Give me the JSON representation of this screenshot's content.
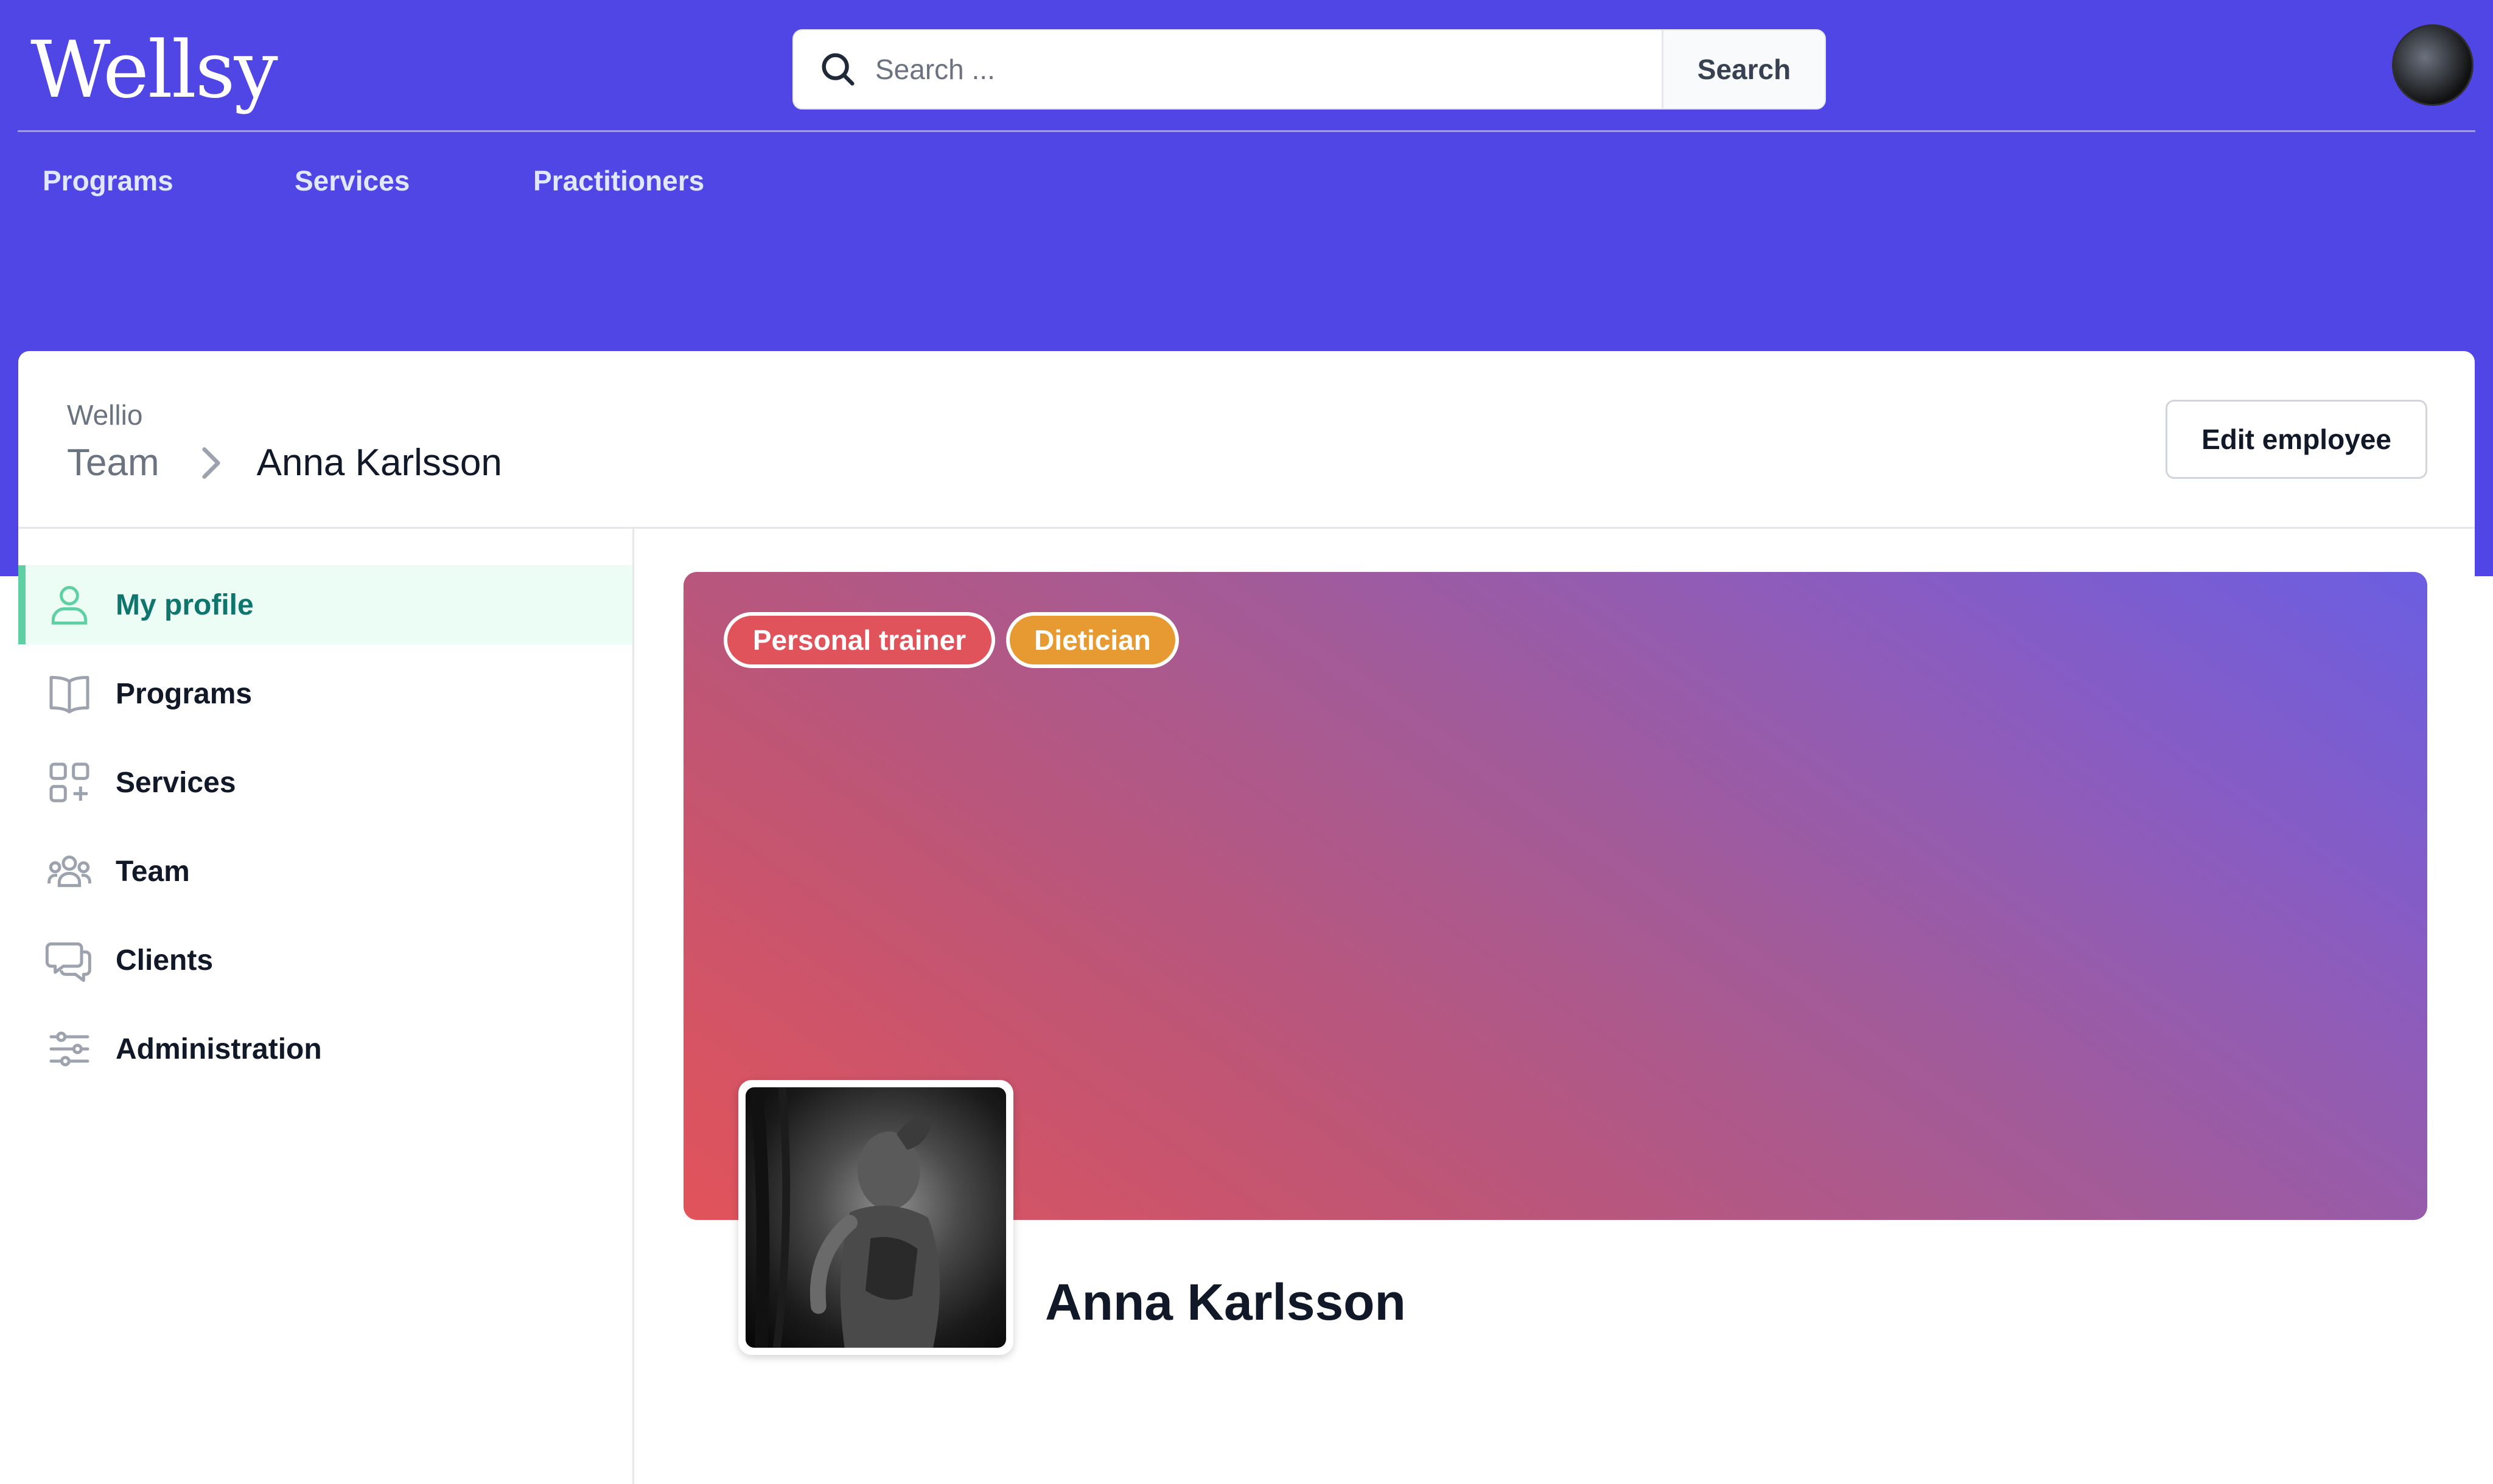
{
  "app": {
    "logo": "Wellsy"
  },
  "search": {
    "placeholder": "Search ...",
    "value": "",
    "button_label": "Search"
  },
  "top_nav": [
    "Programs",
    "Services",
    "Practitioners"
  ],
  "breadcrumb": {
    "root": "Wellio",
    "section": "Team",
    "current": "Anna Karlsson"
  },
  "header": {
    "edit_button": "Edit employee"
  },
  "sidebar": {
    "items": [
      {
        "label": "My profile",
        "icon": "user-icon",
        "active": true
      },
      {
        "label": "Programs",
        "icon": "book-icon",
        "active": false
      },
      {
        "label": "Services",
        "icon": "grid-plus-icon",
        "active": false
      },
      {
        "label": "Team",
        "icon": "users-icon",
        "active": false
      },
      {
        "label": "Clients",
        "icon": "chat-icon",
        "active": false
      },
      {
        "label": "Administration",
        "icon": "sliders-icon",
        "active": false
      }
    ]
  },
  "profile": {
    "name": "Anna Karlsson",
    "tags": [
      {
        "label": "Personal trainer",
        "color": "#e0535a"
      },
      {
        "label": "Dietician",
        "color": "#e79a32"
      }
    ]
  },
  "colors": {
    "brand": "#4f46e5",
    "active_accent": "#5fcfa4",
    "active_bg": "#ecfdf5",
    "active_text": "#0f766e"
  }
}
